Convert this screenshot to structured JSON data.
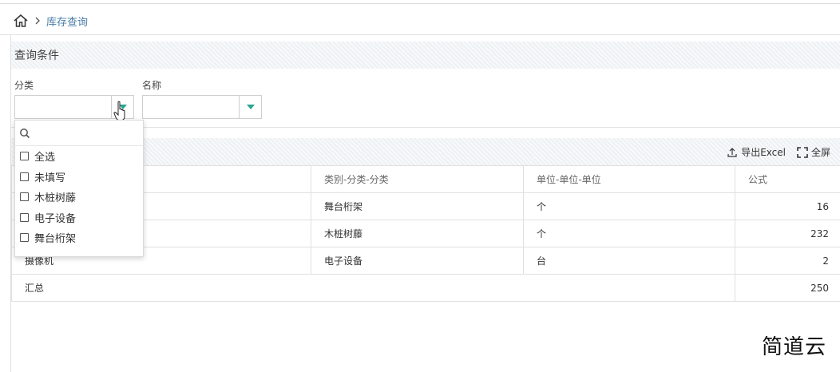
{
  "breadcrumb": {
    "current": "库存查询"
  },
  "query_panel": {
    "title": "查询条件",
    "category_label": "分类",
    "category_value": "",
    "name_label": "名称",
    "name_value": ""
  },
  "dropdown": {
    "search_placeholder": "",
    "options": [
      "全选",
      "未填写",
      "木桩树藤",
      "电子设备",
      "舞台桁架"
    ]
  },
  "toolbar": {
    "export_label": "导出Excel",
    "fullscreen_label": "全屏"
  },
  "table": {
    "headers": [
      "",
      "类别-分类-分类",
      "单位-单位-单位",
      "公式"
    ],
    "rows": [
      {
        "name": "",
        "category": "舞台桁架",
        "unit": "个",
        "formula": "16"
      },
      {
        "name": "",
        "category": "木桩树藤",
        "unit": "个",
        "formula": "232"
      },
      {
        "name": "摄像机",
        "category": "电子设备",
        "unit": "台",
        "formula": "2"
      }
    ],
    "total_label": "汇总",
    "total_value": "250"
  },
  "watermark": "简道云",
  "colors": {
    "accent": "#2aa58f",
    "link": "#4a7ea8"
  }
}
